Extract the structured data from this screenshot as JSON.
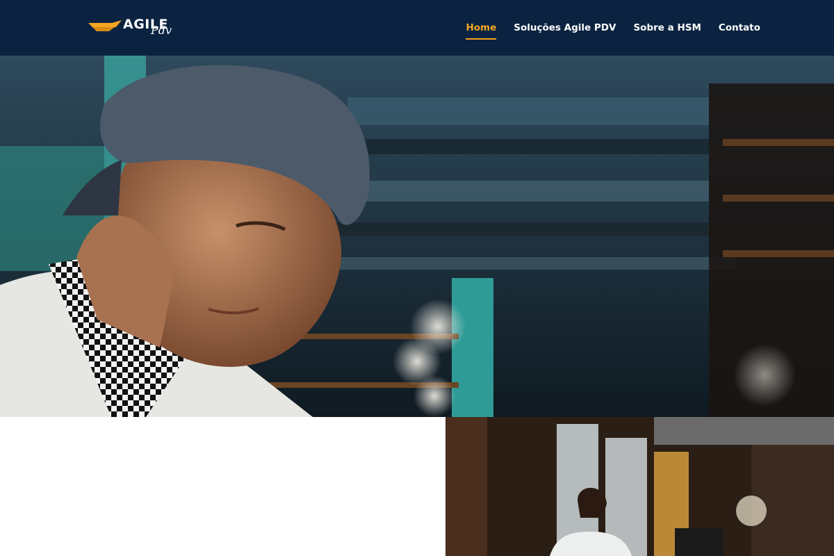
{
  "brand": {
    "logo_text": "AGILE",
    "logo_script": "Pdv",
    "accent_color": "#f5a623",
    "header_bg": "#0b2341"
  },
  "nav": {
    "items": [
      {
        "label": "Home",
        "active": true
      },
      {
        "label": "Soluções Agile PDV",
        "active": false
      },
      {
        "label": "Sobre a HSM",
        "active": false
      },
      {
        "label": "Contato",
        "active": false
      }
    ]
  },
  "images": {
    "hero": "chef-in-restaurant-photo",
    "secondary": "waitress-at-pos-terminal-photo"
  }
}
